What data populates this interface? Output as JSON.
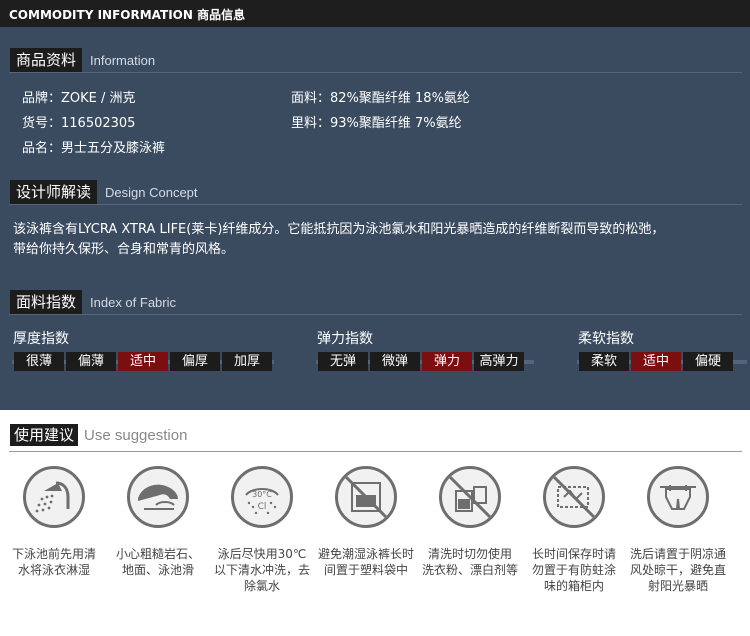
{
  "header": {
    "title": "COMMODITY INFORMATION 商品信息"
  },
  "product_info": {
    "title": "商品资料",
    "subtitle": "Information",
    "brand": "品牌：ZOKE / 洲克",
    "item_no": "货号：116502305",
    "name": "品名：男士五分及膝泳裤",
    "fabric": "面料：82%聚酯纤维 18%氨纶",
    "lining": "里料：93%聚酯纤维 7%氨纶"
  },
  "design": {
    "title": "设计师解读",
    "subtitle": "Design Concept",
    "text_line1": "该泳裤含有LYCRA XTRA LIFE(莱卡)纤维成分。它能抵抗因为泳池氯水和阳光暴晒造成的纤维断裂而导致的松弛，",
    "text_line2": "带给你持久保形、合身和常青的风格。"
  },
  "fabric_index": {
    "title": "面料指数",
    "subtitle": "Index of Fabric",
    "thickness": {
      "label": "厚度指数",
      "options": [
        "很薄",
        "偏薄",
        "适中",
        "偏厚",
        "加厚"
      ],
      "selected": "适中"
    },
    "elasticity": {
      "label": "弹力指数",
      "options": [
        "无弹",
        "微弹",
        "弹力",
        "高弹力"
      ],
      "selected": "弹力"
    },
    "softness": {
      "label": "柔软指数",
      "options": [
        "柔软",
        "适中",
        "偏硬"
      ],
      "selected": "适中"
    }
  },
  "usage": {
    "title": "使用建议",
    "subtitle": "Use suggestion",
    "tips": [
      {
        "icon": "shower-icon",
        "text": "下泳池前先用清水将泳衣淋湿"
      },
      {
        "icon": "rock-icon",
        "text": "小心粗糙岩石、地面、泳池滑"
      },
      {
        "icon": "wash-30c-icon",
        "text": "泳后尽快用30℃以下清水冲洗，去除氯水"
      },
      {
        "icon": "no-plastic-bag-icon",
        "text": "避免潮湿泳裤长时间置于塑料袋中"
      },
      {
        "icon": "no-detergent-icon",
        "text": "清洗时切勿使用洗衣粉、漂白剂等"
      },
      {
        "icon": "no-mothball-icon",
        "text": "长时间保存时请勿置于有防蛀涂味的箱柜内"
      },
      {
        "icon": "shade-dry-icon",
        "text": "洗后请置于阴凉通风处晾干，避免直射阳光暴晒"
      }
    ],
    "tip_lines": [
      [
        "下泳池前先用清",
        "水将泳衣淋湿"
      ],
      [
        "小心粗糙岩石、",
        "地面、泳池滑"
      ],
      [
        "泳后尽快用30℃",
        "以下清水冲洗，去",
        "除氯水"
      ],
      [
        "避免潮湿泳裤长时",
        "间置于塑料袋中"
      ],
      [
        "清洗时切勿使用",
        "洗衣粉、漂白剂等"
      ],
      [
        "长时间保存时请",
        "勿置于有防蛀涂",
        "味的箱柜内"
      ],
      [
        "洗后请置于阴凉通",
        "风处晾干，避免直",
        "射阳光暴晒"
      ]
    ]
  },
  "colors": {
    "panel": "#3a4a5f",
    "tag": "#1c1c1c",
    "selected": "#7b0f0f",
    "icon_stroke": "#6e6e6e"
  }
}
